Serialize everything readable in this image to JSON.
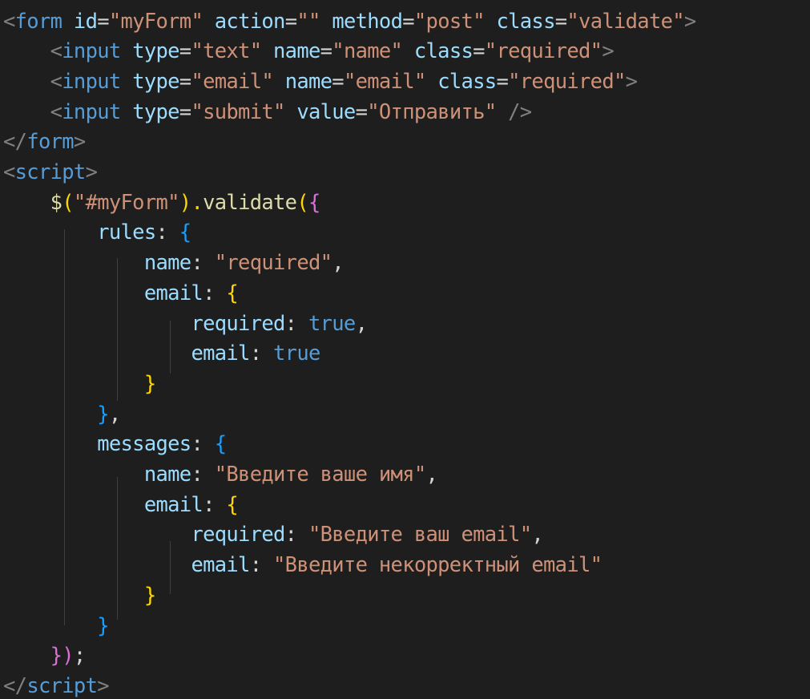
{
  "code_lines": [
    [
      {
        "t": "<",
        "c": "tag-bracket"
      },
      {
        "t": "form",
        "c": "tag"
      },
      {
        "t": " ",
        "c": "punct"
      },
      {
        "t": "id",
        "c": "attr"
      },
      {
        "t": "=",
        "c": "punct"
      },
      {
        "t": "\"myForm\"",
        "c": "string"
      },
      {
        "t": " ",
        "c": "punct"
      },
      {
        "t": "action",
        "c": "attr"
      },
      {
        "t": "=",
        "c": "punct"
      },
      {
        "t": "\"\"",
        "c": "string"
      },
      {
        "t": " ",
        "c": "punct"
      },
      {
        "t": "method",
        "c": "attr"
      },
      {
        "t": "=",
        "c": "punct"
      },
      {
        "t": "\"post\"",
        "c": "string"
      },
      {
        "t": " ",
        "c": "punct"
      },
      {
        "t": "class",
        "c": "attr"
      },
      {
        "t": "=",
        "c": "punct"
      },
      {
        "t": "\"validate\"",
        "c": "string"
      },
      {
        "t": ">",
        "c": "tag-bracket"
      }
    ],
    [
      {
        "t": "    ",
        "c": "punct"
      },
      {
        "t": "<",
        "c": "tag-bracket"
      },
      {
        "t": "input",
        "c": "tag"
      },
      {
        "t": " ",
        "c": "punct"
      },
      {
        "t": "type",
        "c": "attr"
      },
      {
        "t": "=",
        "c": "punct"
      },
      {
        "t": "\"text\"",
        "c": "string"
      },
      {
        "t": " ",
        "c": "punct"
      },
      {
        "t": "name",
        "c": "attr"
      },
      {
        "t": "=",
        "c": "punct"
      },
      {
        "t": "\"name\"",
        "c": "string"
      },
      {
        "t": " ",
        "c": "punct"
      },
      {
        "t": "class",
        "c": "attr"
      },
      {
        "t": "=",
        "c": "punct"
      },
      {
        "t": "\"required\"",
        "c": "string"
      },
      {
        "t": ">",
        "c": "tag-bracket"
      }
    ],
    [
      {
        "t": "    ",
        "c": "punct"
      },
      {
        "t": "<",
        "c": "tag-bracket"
      },
      {
        "t": "input",
        "c": "tag"
      },
      {
        "t": " ",
        "c": "punct"
      },
      {
        "t": "type",
        "c": "attr"
      },
      {
        "t": "=",
        "c": "punct"
      },
      {
        "t": "\"email\"",
        "c": "string"
      },
      {
        "t": " ",
        "c": "punct"
      },
      {
        "t": "name",
        "c": "attr"
      },
      {
        "t": "=",
        "c": "punct"
      },
      {
        "t": "\"email\"",
        "c": "string"
      },
      {
        "t": " ",
        "c": "punct"
      },
      {
        "t": "class",
        "c": "attr"
      },
      {
        "t": "=",
        "c": "punct"
      },
      {
        "t": "\"required\"",
        "c": "string"
      },
      {
        "t": ">",
        "c": "tag-bracket"
      }
    ],
    [
      {
        "t": "    ",
        "c": "punct"
      },
      {
        "t": "<",
        "c": "tag-bracket"
      },
      {
        "t": "input",
        "c": "tag"
      },
      {
        "t": " ",
        "c": "punct"
      },
      {
        "t": "type",
        "c": "attr"
      },
      {
        "t": "=",
        "c": "punct"
      },
      {
        "t": "\"submit\"",
        "c": "string"
      },
      {
        "t": " ",
        "c": "punct"
      },
      {
        "t": "value",
        "c": "attr"
      },
      {
        "t": "=",
        "c": "punct"
      },
      {
        "t": "\"Отправить\"",
        "c": "string"
      },
      {
        "t": " ",
        "c": "punct"
      },
      {
        "t": "/>",
        "c": "tag-bracket"
      }
    ],
    [
      {
        "t": "</",
        "c": "tag-bracket"
      },
      {
        "t": "form",
        "c": "tag"
      },
      {
        "t": ">",
        "c": "tag-bracket"
      }
    ],
    [
      {
        "t": "<",
        "c": "tag-bracket"
      },
      {
        "t": "script",
        "c": "tag"
      },
      {
        "t": ">",
        "c": "tag-bracket"
      }
    ],
    [
      {
        "t": "    ",
        "c": "punct"
      },
      {
        "t": "$",
        "c": "func"
      },
      {
        "t": "(",
        "c": "brace-yellow"
      },
      {
        "t": "\"#myForm\"",
        "c": "string"
      },
      {
        "t": ").",
        "c": "brace-yellow"
      },
      {
        "t": "validate",
        "c": "func"
      },
      {
        "t": "(",
        "c": "brace-yellow"
      },
      {
        "t": "{",
        "c": "brace-purple"
      }
    ],
    [
      {
        "t": "        ",
        "c": "punct"
      },
      {
        "t": "rules",
        "c": "key"
      },
      {
        "t": ": ",
        "c": "punct"
      },
      {
        "t": "{",
        "c": "brace-blue"
      }
    ],
    [
      {
        "t": "            ",
        "c": "punct"
      },
      {
        "t": "name",
        "c": "key"
      },
      {
        "t": ": ",
        "c": "punct"
      },
      {
        "t": "\"required\"",
        "c": "string"
      },
      {
        "t": ",",
        "c": "punct"
      }
    ],
    [
      {
        "t": "            ",
        "c": "punct"
      },
      {
        "t": "email",
        "c": "key"
      },
      {
        "t": ": ",
        "c": "punct"
      },
      {
        "t": "{",
        "c": "brace-yellow"
      }
    ],
    [
      {
        "t": "                ",
        "c": "punct"
      },
      {
        "t": "required",
        "c": "key"
      },
      {
        "t": ": ",
        "c": "punct"
      },
      {
        "t": "true",
        "c": "bool"
      },
      {
        "t": ",",
        "c": "punct"
      }
    ],
    [
      {
        "t": "                ",
        "c": "punct"
      },
      {
        "t": "email",
        "c": "key"
      },
      {
        "t": ": ",
        "c": "punct"
      },
      {
        "t": "true",
        "c": "bool"
      }
    ],
    [
      {
        "t": "            ",
        "c": "punct"
      },
      {
        "t": "}",
        "c": "brace-yellow"
      }
    ],
    [
      {
        "t": "        ",
        "c": "punct"
      },
      {
        "t": "}",
        "c": "brace-blue"
      },
      {
        "t": ",",
        "c": "punct"
      }
    ],
    [
      {
        "t": "        ",
        "c": "punct"
      },
      {
        "t": "messages",
        "c": "key"
      },
      {
        "t": ": ",
        "c": "punct"
      },
      {
        "t": "{",
        "c": "brace-blue"
      }
    ],
    [
      {
        "t": "            ",
        "c": "punct"
      },
      {
        "t": "name",
        "c": "key"
      },
      {
        "t": ": ",
        "c": "punct"
      },
      {
        "t": "\"Введите ваше имя\"",
        "c": "string"
      },
      {
        "t": ",",
        "c": "punct"
      }
    ],
    [
      {
        "t": "            ",
        "c": "punct"
      },
      {
        "t": "email",
        "c": "key"
      },
      {
        "t": ": ",
        "c": "punct"
      },
      {
        "t": "{",
        "c": "brace-yellow"
      }
    ],
    [
      {
        "t": "                ",
        "c": "punct"
      },
      {
        "t": "required",
        "c": "key"
      },
      {
        "t": ": ",
        "c": "punct"
      },
      {
        "t": "\"Введите ваш email\"",
        "c": "string"
      },
      {
        "t": ",",
        "c": "punct"
      }
    ],
    [
      {
        "t": "                ",
        "c": "punct"
      },
      {
        "t": "email",
        "c": "key"
      },
      {
        "t": ": ",
        "c": "punct"
      },
      {
        "t": "\"Введите некорректный email\"",
        "c": "string"
      }
    ],
    [
      {
        "t": "            ",
        "c": "punct"
      },
      {
        "t": "}",
        "c": "brace-yellow"
      }
    ],
    [
      {
        "t": "        ",
        "c": "punct"
      },
      {
        "t": "}",
        "c": "brace-blue"
      }
    ],
    [
      {
        "t": "    ",
        "c": "punct"
      },
      {
        "t": "})",
        "c": "brace-purple"
      },
      {
        "t": ";",
        "c": "punct"
      }
    ],
    [
      {
        "t": "</",
        "c": "tag-bracket"
      },
      {
        "t": "script",
        "c": "tag"
      },
      {
        "t": ">",
        "c": "tag-bracket"
      }
    ]
  ],
  "colors": {
    "background": "#1e1e1e",
    "tag": "#569cd6",
    "attribute": "#9cdcfe",
    "string": "#ce9178",
    "function": "#dcdcaa",
    "bracket_gold": "#ffd700",
    "bracket_blue": "#179fff",
    "bracket_purple": "#da70d6"
  }
}
